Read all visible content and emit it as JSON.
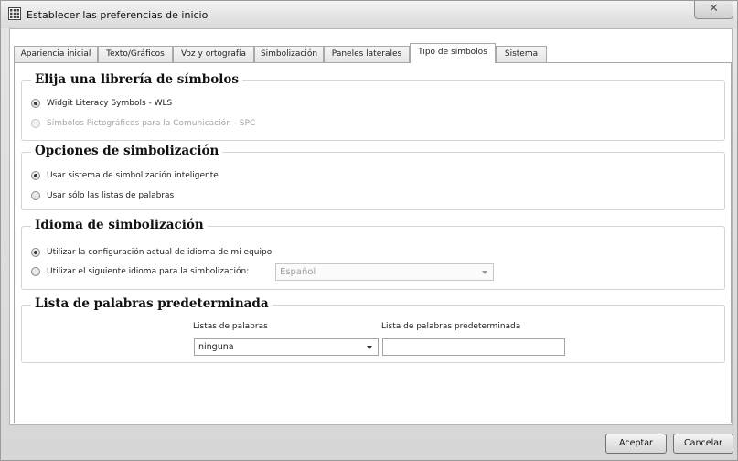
{
  "window": {
    "title": "Establecer las preferencias de inicio",
    "close_glyph": "✕",
    "icon": "grid-app-icon"
  },
  "tabs": [
    {
      "label": "Apariencia inicial",
      "active": false
    },
    {
      "label": "Texto/Gráficos",
      "active": false
    },
    {
      "label": "Voz y ortografía",
      "active": false
    },
    {
      "label": "Simbolización",
      "active": false
    },
    {
      "label": "Paneles laterales",
      "active": false
    },
    {
      "label": "Tipo de símbolos",
      "active": true
    },
    {
      "label": "Sistema",
      "active": false
    }
  ],
  "library_group": {
    "title": "Elija una librería de símbolos",
    "options": [
      {
        "label": "Widgit Literacy Symbols - WLS",
        "selected": true,
        "enabled": true
      },
      {
        "label": "Símbolos Pictográficos para la Comunicación - SPC",
        "selected": false,
        "enabled": false
      }
    ]
  },
  "symbolization_group": {
    "title": "Opciones de simbolización",
    "options": [
      {
        "label": "Usar sistema de simbolización inteligente",
        "selected": true
      },
      {
        "label": "Usar sólo las listas de palabras",
        "selected": false
      }
    ]
  },
  "language_group": {
    "title": "Idioma de simbolización",
    "options": [
      {
        "label": "Utilizar la configuración actual de idioma de mi equipo",
        "selected": true
      },
      {
        "label": "Utilizar el siguiente idioma para la simbolización:",
        "selected": false
      }
    ],
    "language_select": {
      "value": "Español",
      "enabled": false
    }
  },
  "wordlist_group": {
    "title": "Lista de palabras predeterminada",
    "lists_label": "Listas de palabras",
    "lists_value": "ninguna",
    "default_label": "Lista de palabras predeterminada",
    "default_value": ""
  },
  "footer": {
    "ok_label": "Aceptar",
    "cancel_label": "Cancelar"
  }
}
